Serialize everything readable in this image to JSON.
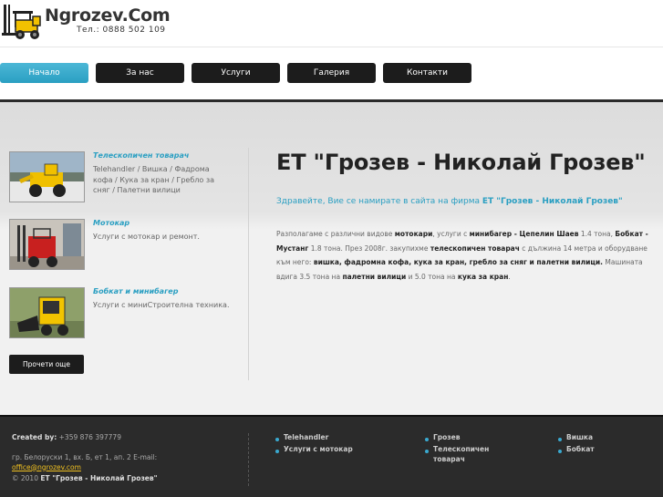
{
  "header": {
    "brand": "Ngrozev.Com",
    "phone": "Тел.: 0888 502 109"
  },
  "nav": {
    "items": [
      {
        "label": "Начало",
        "active": true
      },
      {
        "label": "За нас"
      },
      {
        "label": "Услуги"
      },
      {
        "label": "Галерия"
      },
      {
        "label": "Контакти"
      }
    ]
  },
  "sidebar": {
    "items": [
      {
        "title": "Телескопичен товарач",
        "text": "Telehandler / Вишка / Фадрома кофа / Кука за кран / Гребло за сняг / Палетни вилици"
      },
      {
        "title": "Мотокар",
        "text": "Услуги с мотокар и ремонт."
      },
      {
        "title": "Бобкат и минибагер",
        "text": "Услуги с миниСтроителна техника."
      }
    ],
    "read_more": "Прочети още"
  },
  "main": {
    "title": "ЕТ \"Грозев - Николай Грозев\"",
    "welcome_prefix": "Здравейте, Вие се намирате в сайта на фирма ",
    "welcome_company": "ЕТ \"Грозев - Николай Грозев\"",
    "p1": "Разполагаме с различни видове ",
    "p2": "мотокари",
    "p3": ", услуги с ",
    "p4": "минибагер - Цепелин Шаев",
    "p5": " 1.4 тона, ",
    "p6": "Бобкат - Мустанг",
    "p7": " 1.8 тона. През 2008г. закупихме ",
    "p8": "телескопичен товарач",
    "p9": " с дължина 14 метра и оборудване към него: ",
    "p10": "вишка, фадромна кофа, кука за кран, гребло за сняг и палетни вилици.",
    "p11": " Машината вдига 3.5 тона на ",
    "p12": "палетни вилици",
    "p13": " и 5.0 тона на ",
    "p14": "кука за кран",
    "p15": "."
  },
  "footer": {
    "created_label": "Created by:",
    "created_value": " +359 876 397779",
    "address": "гр. Белоруски 1, вх. Б, ет 1, ап. 2 E-mail:",
    "email": "office@ngrozev.com",
    "copy_prefix": "© 2010 ",
    "copy_company": "ЕТ \"Грозев - Николай Грозев\"",
    "links": [
      "Telehandler",
      "Услуги с мотокар",
      "Грозев",
      "Телескопичен товарач",
      "Вишка",
      "Бобкат"
    ]
  },
  "colors": {
    "accent": "#2a9fc2",
    "dark": "#1c1c1c",
    "footer": "#2b2b2b",
    "email": "#f0c020"
  }
}
